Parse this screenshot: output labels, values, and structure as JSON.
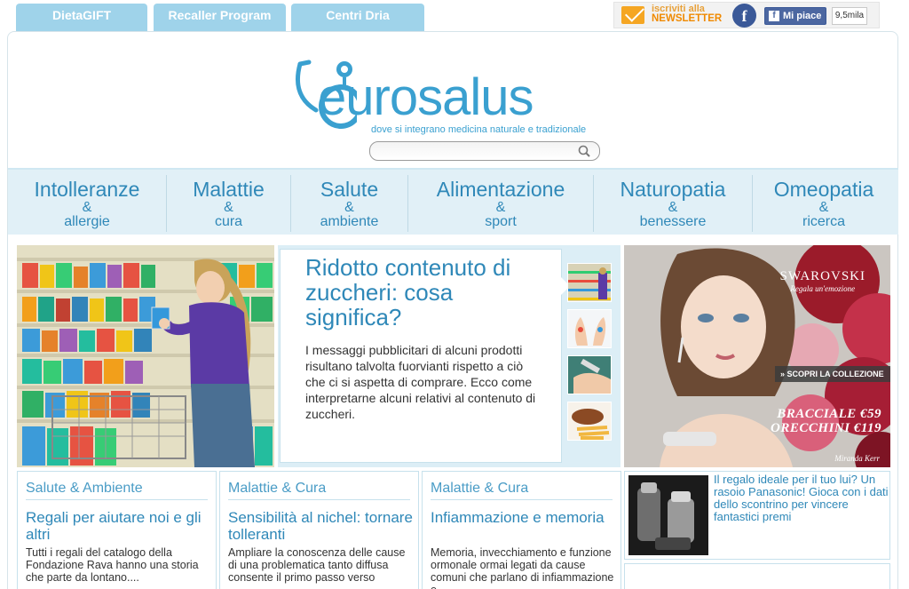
{
  "top_tabs": [
    "DietaGIFT",
    "Recaller Program",
    "Centri Dria"
  ],
  "social": {
    "newsletter_line1": "iscriviti alla",
    "newsletter_line2": "NEWSLETTER",
    "fb_letter": "f",
    "like_icon": "f",
    "like_label": "Mi piace",
    "like_count": "9,5mila"
  },
  "logo": {
    "wordmark": "eurosalus",
    "tagline": "dove si integrano medicina naturale e tradizionale"
  },
  "search": {
    "placeholder": ""
  },
  "nav": [
    {
      "main": "Intolleranze",
      "amp": "&",
      "sub": "allergie"
    },
    {
      "main": "Malattie",
      "amp": "&",
      "sub": "cura"
    },
    {
      "main": "Salute",
      "amp": "&",
      "sub": "ambiente"
    },
    {
      "main": "Alimentazione",
      "amp": "&",
      "sub": "sport"
    },
    {
      "main": "Naturopatia",
      "amp": "&",
      "sub": "benessere"
    },
    {
      "main": "Omeopatia",
      "amp": "&",
      "sub": "ricerca"
    }
  ],
  "feature": {
    "title": "Ridotto contenuto di zuccheri: cosa significa?",
    "text": "I messaggi pubblicitari di alcuni prodotti risultano talvolta fuorvianti rispetto a ciò che ci si aspetta di comprare. Ecco come interpretarne alcuni relativi al contenuto di zuccheri."
  },
  "ad": {
    "brand": "SWAROVSKI",
    "brand_tag": "Regala un'emozione",
    "button": "» SCOPRI LA COLLEZIONE",
    "price1": "BRACCIALE €59",
    "price2": "ORECCHINI €119",
    "signature": "Miranda Kerr"
  },
  "cards": [
    {
      "section": "Salute & Ambiente",
      "title": "Regali per aiutare noi e gli altri",
      "text": "Tutti i regali del catalogo della Fondazione Rava hanno una storia che parte da lontano...."
    },
    {
      "section": "Malattie & Cura",
      "title": "Sensibilità al nichel: tornare tolleranti",
      "text": "Ampliare la conoscenza delle cause di una problematica tanto diffusa consente il primo passo verso"
    },
    {
      "section": "Malattie & Cura",
      "title": "Infiammazione e memoria",
      "text": "Memoria, invecchiamento e funzione ormonale ormai legati da cause comuni che parlano di infiammazione e"
    }
  ],
  "promo": {
    "text": "Il regalo ideale per il tuo lui? Un rasoio Panasonic! Gioca con i dati dello scontrino per vincere fantastici premi"
  },
  "colors": {
    "accent": "#2f88b8",
    "tab": "#9fd3ea",
    "nav_bg": "#e1f0f7",
    "newsletter": "#f08a00",
    "facebook": "#3b5998"
  }
}
